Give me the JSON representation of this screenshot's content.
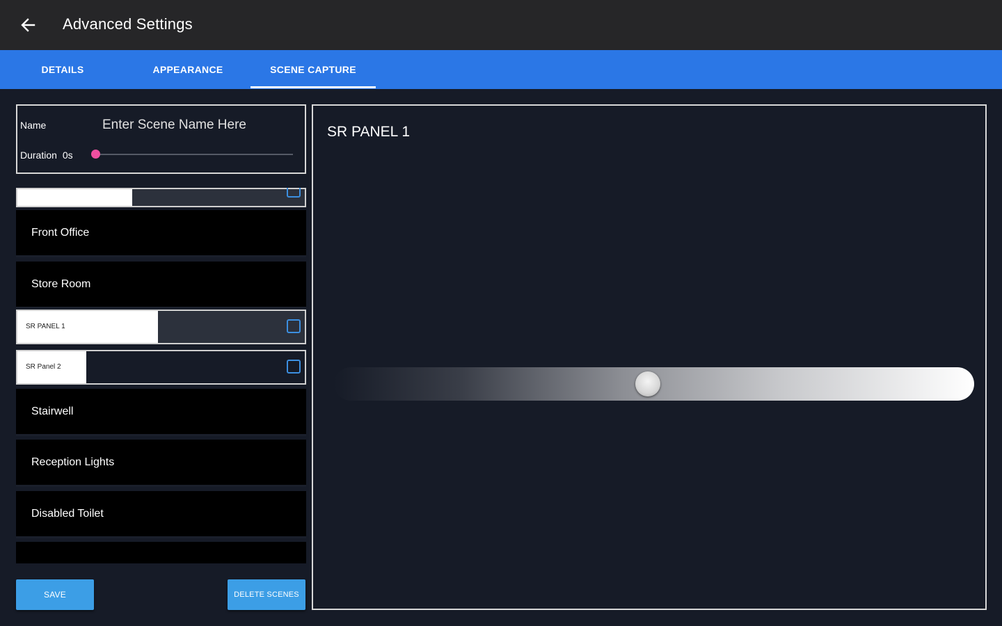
{
  "app_bar": {
    "back_icon": "arrow-left-icon",
    "title": "Advanced Settings"
  },
  "tabs": [
    {
      "label": "DETAILS",
      "selected": false
    },
    {
      "label": "APPEARANCE",
      "selected": false
    },
    {
      "label": "SCENE CAPTURE",
      "selected": true
    }
  ],
  "scene_form": {
    "name_label": "Name",
    "name_placeholder": "Enter Scene Name Here",
    "name_value": "",
    "duration_label": "Duration",
    "duration_value": "0s",
    "duration_fraction": 0.0
  },
  "channels": {
    "partial_top_level": 0.4,
    "items": [
      {
        "label": "Front Office",
        "type": "toggle"
      },
      {
        "label": "Store Room",
        "type": "toggle"
      },
      {
        "label": "SR PANEL 1",
        "type": "level",
        "level": 0.49,
        "checked": false
      },
      {
        "label": "SR Panel 2",
        "type": "level",
        "level": 0.24,
        "checked": false
      },
      {
        "label": "Stairwell",
        "type": "toggle"
      },
      {
        "label": "Reception Lights",
        "type": "toggle"
      },
      {
        "label": "Disabled Toilet",
        "type": "toggle"
      }
    ]
  },
  "buttons": {
    "save": "SAVE",
    "delete": "DELETE SCENES"
  },
  "detail_panel": {
    "title": "SR PANEL 1",
    "level_fraction": 0.49
  },
  "colors": {
    "background": "#161b27",
    "app_bar": "#262628",
    "tab_bar": "#2b77e6",
    "button": "#3c9ee6",
    "duration_thumb": "#ef4fa0",
    "checkbox": "#3c8fe0"
  }
}
